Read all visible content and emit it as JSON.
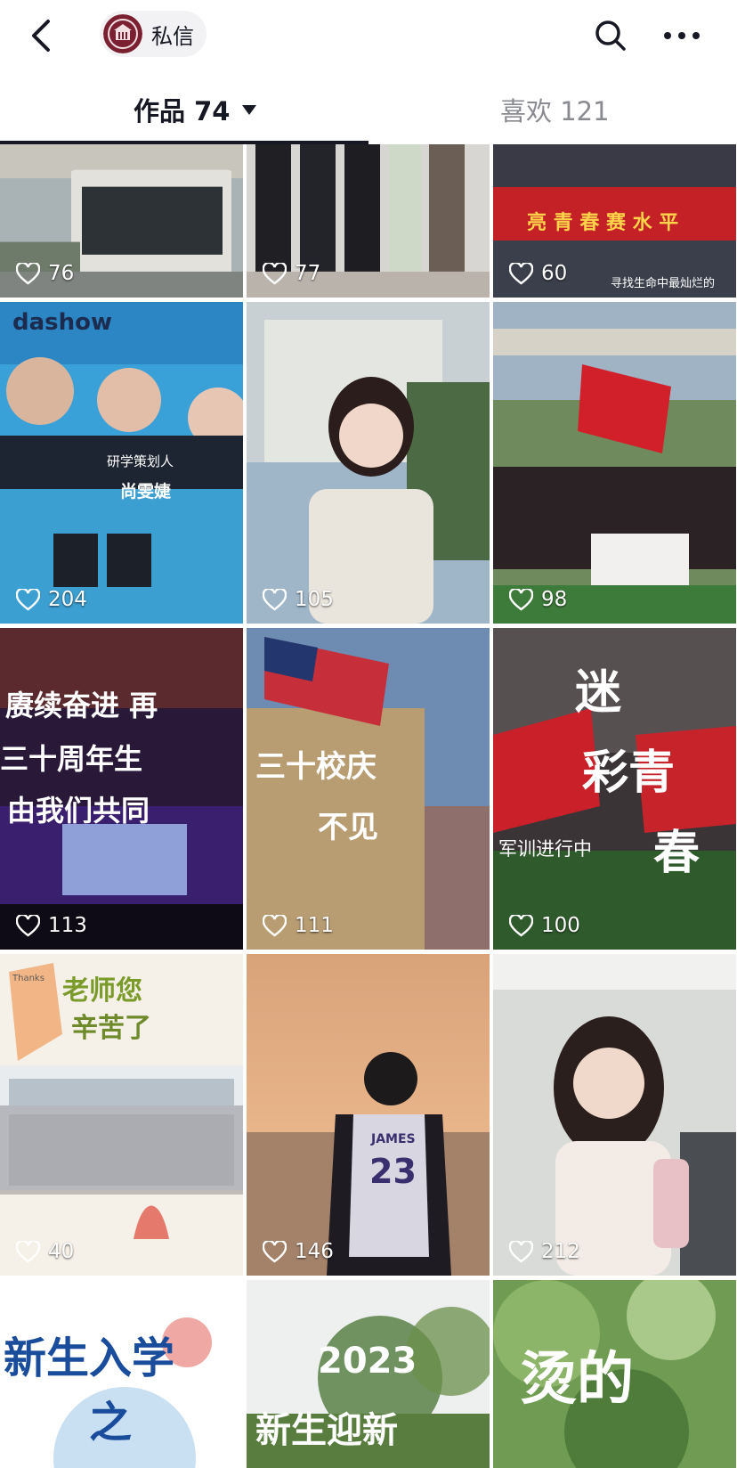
{
  "header": {
    "chip_label": "私信"
  },
  "tabs": [
    {
      "label": "作品 74"
    },
    {
      "label": "喜欢 121"
    }
  ],
  "posts": [
    {
      "likes": "76",
      "overlay": ""
    },
    {
      "likes": "77",
      "overlay": ""
    },
    {
      "likes": "60",
      "overlay": "亮 青 春  赛 水 平",
      "caption": "寻找生命中最灿烂的"
    },
    {
      "likes": "204",
      "overlay": "dashow",
      "sub1": "研学策划人",
      "sub2": "尚雯婕"
    },
    {
      "likes": "105",
      "overlay": ""
    },
    {
      "likes": "98",
      "overlay": ""
    },
    {
      "likes": "113",
      "overlay": "赓续奋进 再",
      "sub1": "三十周年生",
      "sub2": "由我们共同"
    },
    {
      "likes": "111",
      "overlay": "三十校庆",
      "sub1": "不见"
    },
    {
      "likes": "100",
      "overlay": "迷",
      "sub1": "彩青",
      "sub2": "春",
      "caption": "军训进行中"
    },
    {
      "likes": "40",
      "overlay": "老师您",
      "sub1": "辛苦了",
      "caption": "Thanks"
    },
    {
      "likes": "146",
      "overlay": "JAMES",
      "sub1": "23"
    },
    {
      "likes": "212",
      "overlay": ""
    },
    {
      "likes": "",
      "overlay": "新生入学",
      "sub1": "之"
    },
    {
      "likes": "",
      "overlay": "2023",
      "sub1": "新生迎新"
    },
    {
      "likes": "",
      "overlay": "烫的"
    }
  ]
}
